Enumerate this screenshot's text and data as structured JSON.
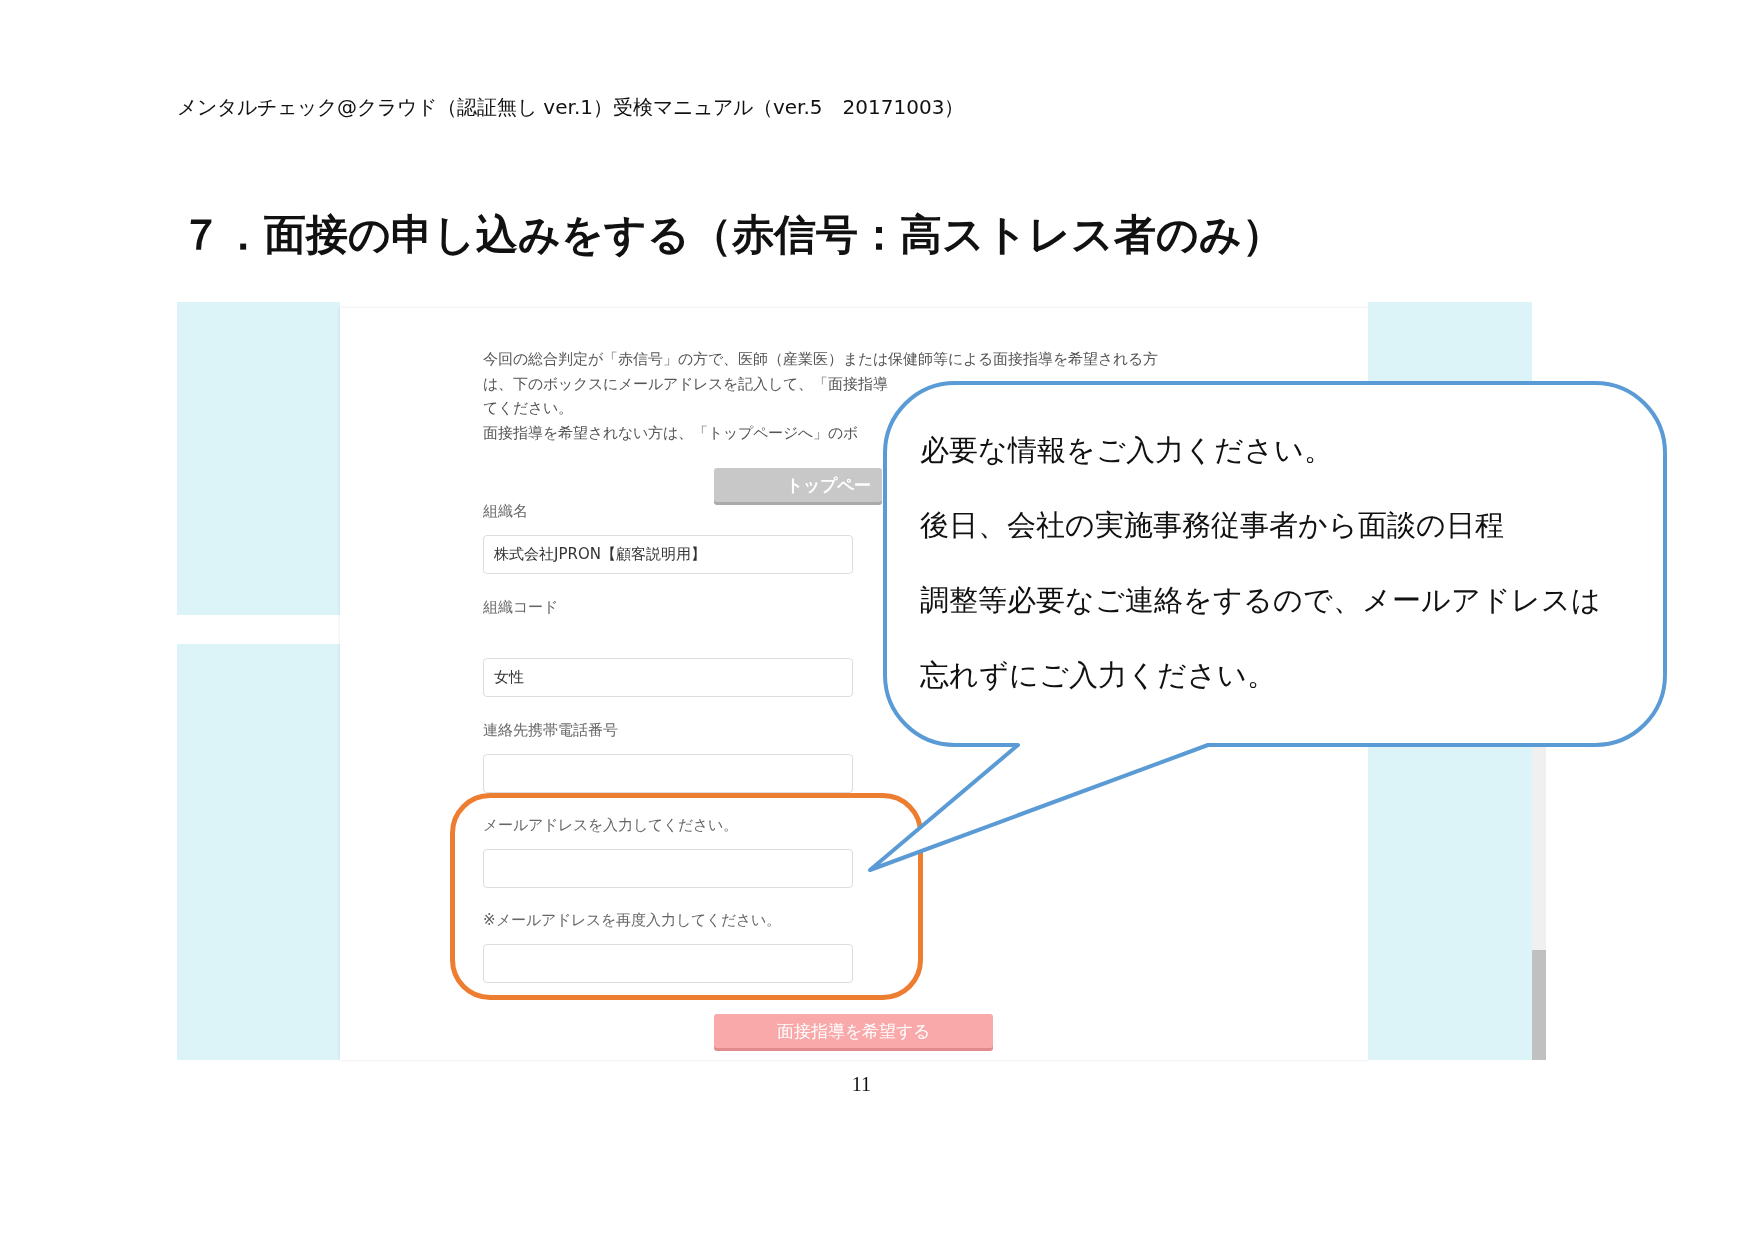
{
  "document_header": "メンタルチェック@クラウド（認証無し ver.1）受検マニュアル（ver.5　20171003）",
  "section_title": "７．面接の申し込みをする（赤信号：高ストレス者のみ）",
  "form": {
    "intro_lines": [
      "今回の総合判定が「赤信号」の方で、医師（産業医）または保健師等による面接指導を希望される方",
      "は、下のボックスにメールアドレスを記入して、「面接指導",
      "てください。",
      "面接指導を希望されない方は、「トップページへ」のボ"
    ],
    "top_button": "トップペー",
    "fields": [
      {
        "label": "組織名",
        "value": "株式会社JPRON【顧客説明用】"
      },
      {
        "label": "組織コード",
        "value": "女性"
      },
      {
        "label": "連絡先携帯電話番号"
      },
      {
        "label": "メールアドレスを入力してください。"
      },
      {
        "label": "※メールアドレスを再度入力してください。"
      }
    ],
    "submit_button": "面接指導を希望する"
  },
  "callout": {
    "lines": [
      "必要な情報をご入力ください。",
      "後日、会社の実施事務従事者から面談の日程",
      "調整等必要なご連絡をするので、メールアドレスは",
      "忘れずにご入力ください。"
    ]
  },
  "page_number": "11"
}
